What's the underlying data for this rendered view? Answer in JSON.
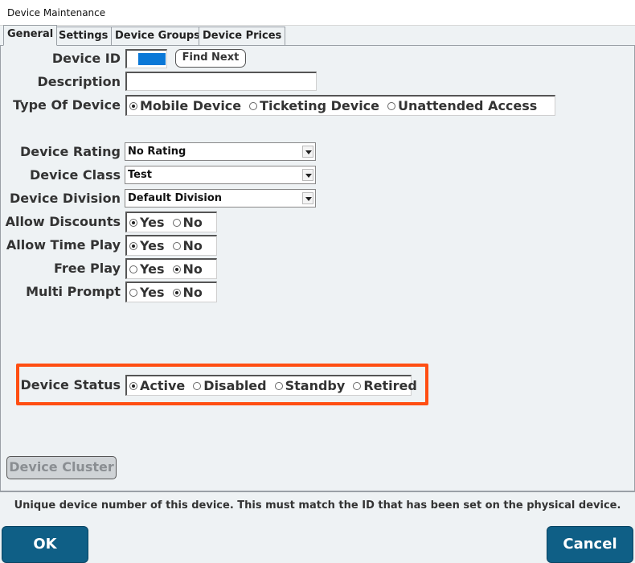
{
  "window": {
    "title": "Device Maintenance"
  },
  "tabs": [
    {
      "label": "General",
      "active": true
    },
    {
      "label": "Settings"
    },
    {
      "label": "Device Groups"
    },
    {
      "label": "Device Prices"
    }
  ],
  "general": {
    "device_id": {
      "label": "Device ID",
      "value": ""
    },
    "find_next_label": "Find Next",
    "description": {
      "label": "Description",
      "value": ""
    },
    "type_of_device": {
      "label": "Type Of Device",
      "options": [
        "Mobile Device",
        "Ticketing Device",
        "Unattended Access"
      ],
      "selected": "Mobile Device"
    },
    "device_rating": {
      "label": "Device Rating",
      "value": "No Rating"
    },
    "device_class": {
      "label": "Device Class",
      "value": "Test"
    },
    "device_division": {
      "label": "Device Division",
      "value": "Default Division"
    },
    "allow_discounts": {
      "label": "Allow Discounts",
      "options": [
        "Yes",
        "No"
      ],
      "selected": "Yes"
    },
    "allow_time_play": {
      "label": "Allow Time Play",
      "options": [
        "Yes",
        "No"
      ],
      "selected": "Yes"
    },
    "free_play": {
      "label": "Free Play",
      "options": [
        "Yes",
        "No"
      ],
      "selected": "No"
    },
    "multi_prompt": {
      "label": "Multi Prompt",
      "options": [
        "Yes",
        "No"
      ],
      "selected": "No"
    },
    "device_status": {
      "label": "Device Status",
      "options": [
        "Active",
        "Disabled",
        "Standby",
        "Retired"
      ],
      "selected": "Active"
    },
    "device_cluster_label": "Device Cluster"
  },
  "footer": {
    "hint": "Unique device number of this device.  This must match the ID that has been set on the physical device.",
    "ok_label": "OK",
    "cancel_label": "Cancel"
  },
  "colors": {
    "accent_button": "#0f5f86",
    "highlight": "#ff4e12",
    "selection": "#0a78d7"
  }
}
